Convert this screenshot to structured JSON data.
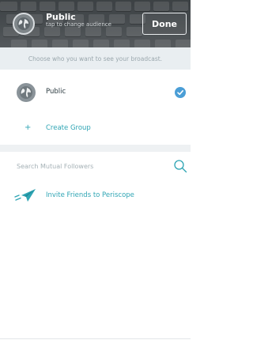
{
  "header": {
    "title": "Public",
    "subtitle": "tap to change audience",
    "done_label": "Done",
    "icon": "globe-icon"
  },
  "banner": {
    "text": "Choose who you want to see your broadcast."
  },
  "audience": {
    "public_label": "Public",
    "public_selected": true,
    "create_group_label": "Create Group",
    "create_group_icon": "plus-icon"
  },
  "search": {
    "placeholder": "Search Mutual Followers",
    "value": ""
  },
  "invite": {
    "label": "Invite Friends to Periscope",
    "icon": "paper-plane-icon"
  },
  "colors": {
    "accent": "#2fa5b4",
    "check": "#4b9ed6",
    "banner_bg": "#e9eef1"
  }
}
